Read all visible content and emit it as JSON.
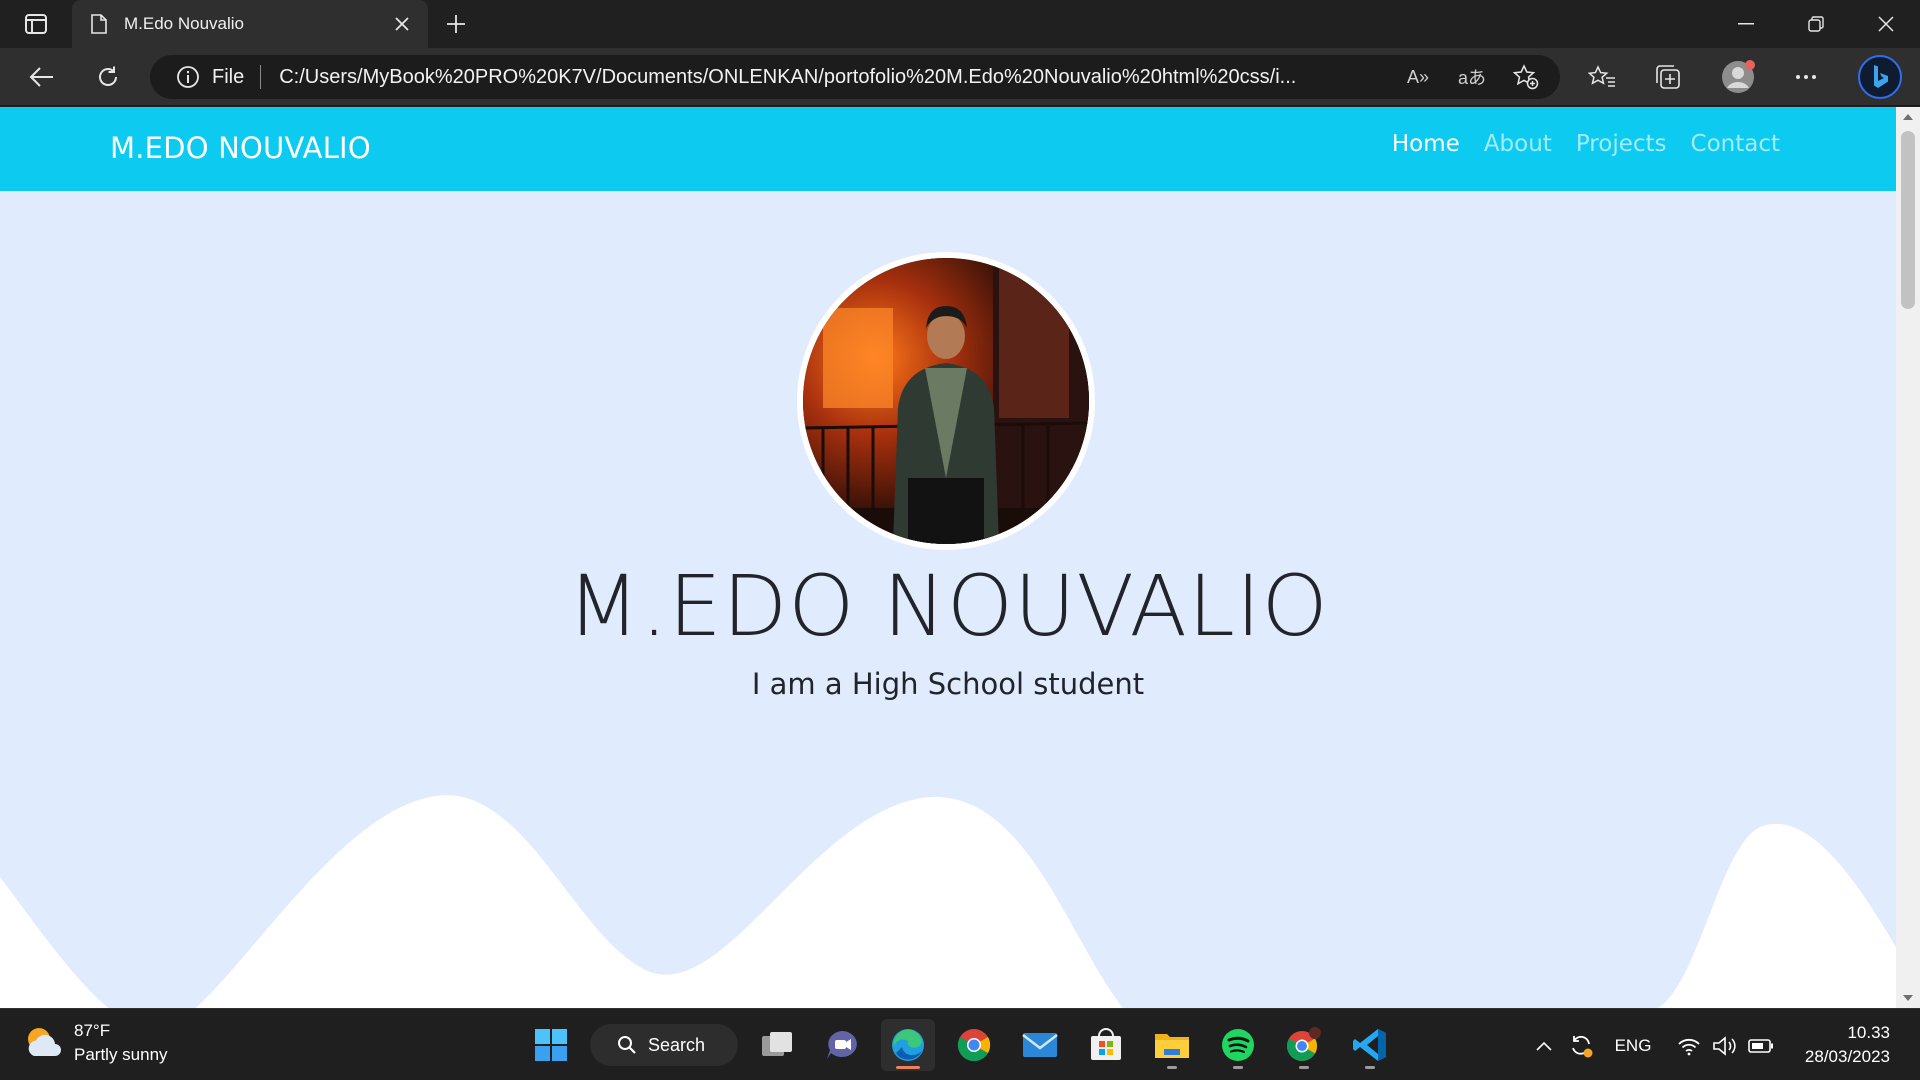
{
  "browser": {
    "tab_title": "M.Edo Nouvalio",
    "scheme_label": "File",
    "url": "C:/Users/MyBook%20PRO%20K7V/Documents/ONLENKAN/portofolio%20M.Edo%20Nouvalio%20html%20css/i...",
    "read_aloud_glyph": "A»",
    "translate_glyph": "aあ"
  },
  "page": {
    "brand": "M.EDO NOUVALIO",
    "nav": [
      {
        "label": "Home",
        "active": true
      },
      {
        "label": "About",
        "active": false
      },
      {
        "label": "Projects",
        "active": false
      },
      {
        "label": "Contact",
        "active": false
      }
    ],
    "hero_title": "M.EDO NOUVALIO",
    "hero_subtitle": "I am a High School student",
    "colors": {
      "navbar": "#0dcaf0",
      "page_background": "#e0ecfe",
      "wave": "#ffffff"
    }
  },
  "taskbar": {
    "weather_temp": "87°F",
    "weather_desc": "Partly sunny",
    "search_label": "Search",
    "apps": [
      "task-view-icon",
      "teams-chat-icon",
      "edge-icon",
      "chrome-icon",
      "mail-icon",
      "microsoft-store-icon",
      "file-explorer-icon",
      "spotify-icon",
      "chrome-profile-icon",
      "vscode-icon"
    ],
    "language": "ENG",
    "time": "10.33",
    "date": "28/03/2023"
  }
}
